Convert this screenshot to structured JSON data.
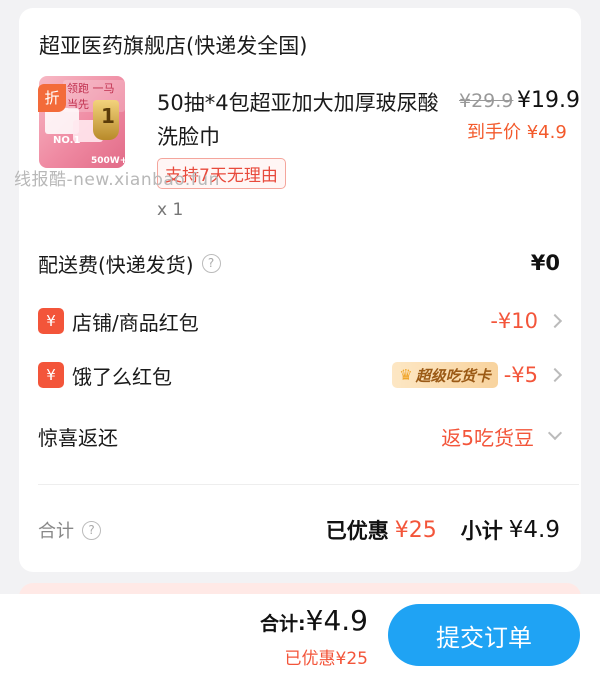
{
  "store": {
    "name": "超亚医药旗舰店(快递发全国)"
  },
  "product": {
    "discount_badge": "折",
    "image_banner": "领跑 一马当先",
    "image_cup_text": "1",
    "image_no1": "NO.1",
    "image_weight": "500W+",
    "title": "50抽*4包超亚加大加厚玻尿酸洗脸巾",
    "original_price": "¥29.9",
    "price": "¥19.9",
    "final_price": "到手价 ¥4.9",
    "return_tag": "支持7天无理由",
    "quantity": "x 1"
  },
  "watermark": "线报酷-new.xianbao.fun",
  "rows": {
    "delivery": {
      "label": "配送费(快递发货)",
      "value": "¥0"
    },
    "store_coupon": {
      "label": "店铺/商品红包",
      "value": "-¥10"
    },
    "eleme_coupon": {
      "label": "饿了么红包",
      "badge": "超级吃货卡",
      "value": "-¥5"
    },
    "surprise": {
      "label": "惊喜返还",
      "value": "返5吃货豆"
    },
    "total": {
      "label": "合计",
      "saved_label": "已优惠",
      "saved_value": "¥25",
      "subtotal_label": "小计",
      "subtotal_value": "¥4.9"
    }
  },
  "icons": {
    "yen": "¥",
    "help": "?",
    "crown": "♛"
  },
  "bottom_bar": {
    "total_label": "合计:",
    "total_value": "¥4.9",
    "saved": "已优惠¥25",
    "submit_label": "提交订单"
  },
  "colors": {
    "accent": "#1fa3f4",
    "price_red": "#f3553a"
  }
}
